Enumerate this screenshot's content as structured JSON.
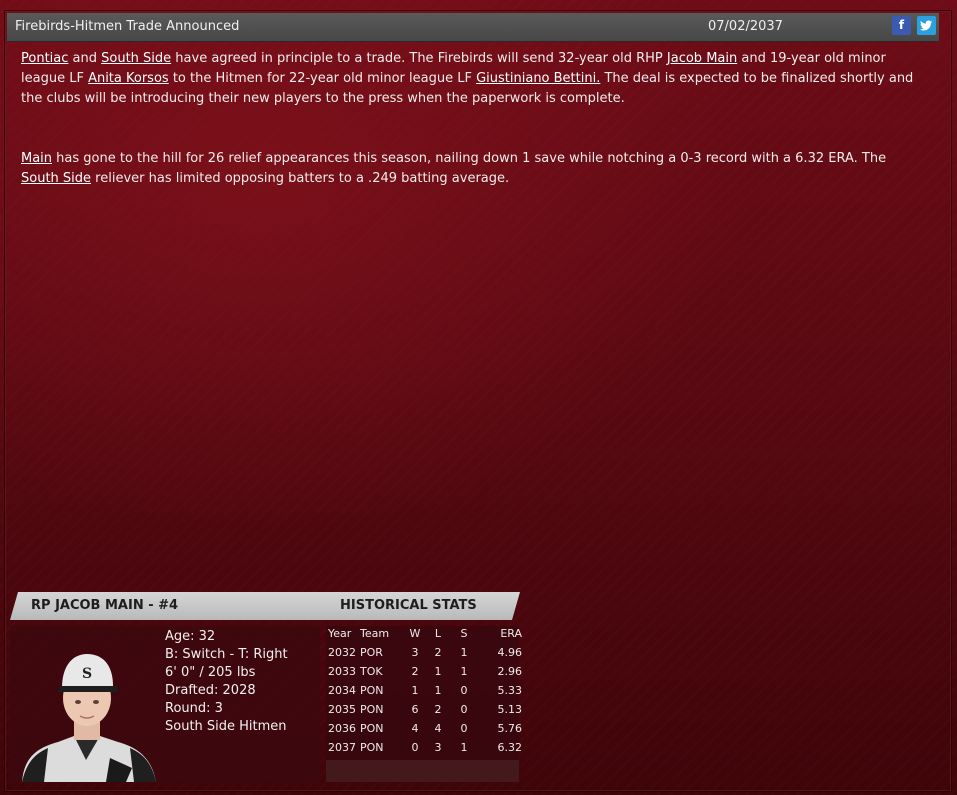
{
  "header": {
    "title": "Firebirds-Hitmen Trade Announced",
    "date": "07/02/2037",
    "facebook_icon": "f",
    "twitter_icon": "t"
  },
  "story": {
    "p1": {
      "team1": "Pontiac",
      "and1": " and ",
      "team2": "South Side",
      "t1": " have agreed in principle to a trade. The Firebirds will send 32-year old RHP ",
      "player1": "Jacob Main",
      "t2": " and 19-year old minor league LF ",
      "player2": "Anita Korsos",
      "t3": " to the Hitmen for 22-year old minor league LF ",
      "player3": "Giustiniano Bettini.",
      "t4": " The deal is expected to be finalized shortly and the clubs will be introducing their new players to the press when the paperwork is complete."
    },
    "p2": {
      "player": "Main",
      "t1": " has gone to the hill for 26 relief appearances this season, nailing down 1 save while notching a 0-3 record with a 6.32 ERA. The ",
      "team": "South Side",
      "t2": " reliever has limited opposing batters to a .249 batting average."
    }
  },
  "player_card": {
    "name": "RP JACOB MAIN - #4",
    "historical_label": "HISTORICAL STATS",
    "bio": {
      "age": "Age: 32",
      "bats_throws": "B: Switch - T: Right",
      "height_weight": "6' 0\" / 205 lbs",
      "drafted": "Drafted: 2028",
      "round": "Round: 3",
      "team": "South Side Hitmen"
    },
    "stats": {
      "headers": [
        "Year",
        "Team",
        "W",
        "L",
        "S",
        "ERA"
      ],
      "rows": [
        [
          "2032",
          "POR",
          "3",
          "2",
          "1",
          "4.96"
        ],
        [
          "2033",
          "TOK",
          "2",
          "1",
          "1",
          "2.96"
        ],
        [
          "2034",
          "PON",
          "1",
          "1",
          "0",
          "5.33"
        ],
        [
          "2035",
          "PON",
          "6",
          "2",
          "0",
          "5.13"
        ],
        [
          "2036",
          "PON",
          "4",
          "4",
          "0",
          "5.76"
        ],
        [
          "2037",
          "PON",
          "0",
          "3",
          "1",
          "6.32"
        ]
      ]
    }
  },
  "colors": {
    "background": "#5a0912",
    "title_bar": "#4f4f4f",
    "card_header": "#c8c8c8",
    "facebook": "#3b5bb0",
    "twitter": "#2aa0e0"
  }
}
